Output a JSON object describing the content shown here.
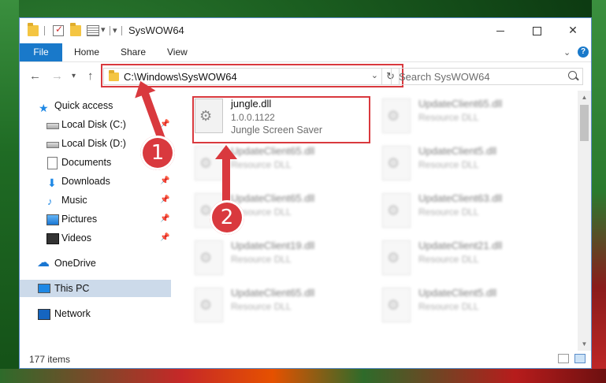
{
  "window": {
    "title": "SysWOW64"
  },
  "ribbon": {
    "tabs": [
      "File",
      "Home",
      "Share",
      "View"
    ]
  },
  "address": {
    "path": "C:\\Windows\\SysWOW64",
    "search_placeholder": "Search SysWOW64"
  },
  "nav": {
    "items": [
      {
        "label": "Quick access",
        "icon": "star-icon",
        "pinned": false
      },
      {
        "label": "Local Disk (C:)",
        "icon": "drive-icon",
        "pinned": true
      },
      {
        "label": "Local Disk (D:)",
        "icon": "drive-icon",
        "pinned": false
      },
      {
        "label": "Documents",
        "icon": "documents-icon",
        "pinned": true
      },
      {
        "label": "Downloads",
        "icon": "downloads-icon",
        "pinned": true
      },
      {
        "label": "Music",
        "icon": "music-icon",
        "pinned": true
      },
      {
        "label": "Pictures",
        "icon": "pictures-icon",
        "pinned": true
      },
      {
        "label": "Videos",
        "icon": "videos-icon",
        "pinned": true
      },
      {
        "label": "OneDrive",
        "icon": "onedrive-icon",
        "pinned": false
      },
      {
        "label": "This PC",
        "icon": "this-pc-icon",
        "pinned": false,
        "selected": true
      },
      {
        "label": "Network",
        "icon": "network-icon",
        "pinned": false
      }
    ]
  },
  "files": [
    {
      "name": "jungle.dll",
      "version": "1.0.0.1122",
      "desc": "Jungle Screen Saver",
      "blurred": false
    },
    {
      "name": "UpdateClient65.dll",
      "desc": "Resource DLL",
      "blurred": true
    },
    {
      "name": "UpdateClient65.dll",
      "desc": "Resource DLL",
      "blurred": true
    },
    {
      "name": "UpdateClient5.dll",
      "desc": "Resource DLL",
      "blurred": true
    },
    {
      "name": "UpdateClient65.dll",
      "desc": "Resource DLL",
      "blurred": true
    },
    {
      "name": "UpdateClient63.dll",
      "desc": "Resource DLL",
      "blurred": true
    },
    {
      "name": "UpdateClient19.dll",
      "desc": "Resource DLL",
      "blurred": true
    },
    {
      "name": "UpdateClient21.dll",
      "desc": "Resource DLL",
      "blurred": true
    },
    {
      "name": "UpdateClient65.dll",
      "desc": "Resource DLL",
      "blurred": true
    },
    {
      "name": "UpdateClient5.dll",
      "desc": "Resource DLL",
      "blurred": true
    }
  ],
  "status": {
    "count": "177 items"
  },
  "annotations": {
    "marker1": "1",
    "marker2": "2",
    "color": "#d9393e"
  }
}
